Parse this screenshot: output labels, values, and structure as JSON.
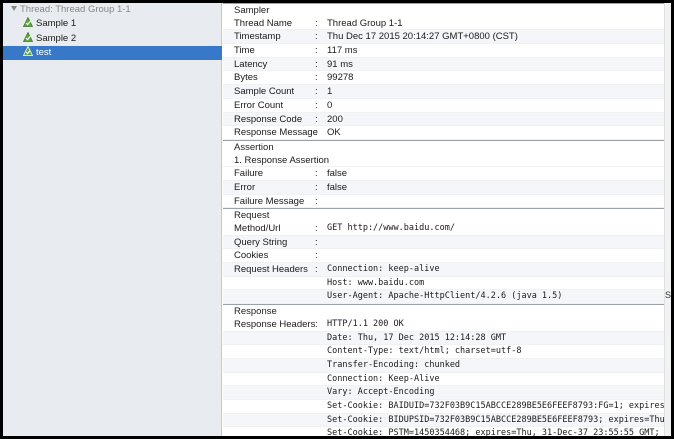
{
  "tree": {
    "root": "Thread: Thread Group 1-1",
    "items": [
      "Sample 1",
      "Sample 2",
      "test"
    ]
  },
  "sampler": {
    "title": "Sampler",
    "rows": [
      {
        "key": "Thread Name",
        "value": "Thread Group 1-1"
      },
      {
        "key": "Timestamp",
        "value": "Thu Dec 17 2015 20:14:27 GMT+0800 (CST)"
      },
      {
        "key": "Time",
        "value": "117 ms"
      },
      {
        "key": "Latency",
        "value": "91 ms"
      },
      {
        "key": "Bytes",
        "value": "99278"
      },
      {
        "key": "Sample Count",
        "value": "1"
      },
      {
        "key": "Error Count",
        "value": "0"
      },
      {
        "key": "Response Code",
        "value": "200"
      },
      {
        "key": "Response Message",
        "value": "OK"
      }
    ]
  },
  "assertion": {
    "title": "Assertion",
    "name": "1. Response Assertion",
    "rows": [
      {
        "key": "Failure",
        "value": "false"
      },
      {
        "key": "Error",
        "value": "false"
      },
      {
        "key": "Failure Message",
        "value": ""
      }
    ]
  },
  "request": {
    "title": "Request",
    "rows": [
      {
        "key": "Method/Url",
        "value": "GET http://www.baidu.com/"
      },
      {
        "key": "Query String",
        "value": ""
      },
      {
        "key": "Cookies",
        "value": ""
      },
      {
        "key": "Request Headers",
        "value": "Connection: keep-alive"
      },
      {
        "key": "",
        "value": "Host: www.baidu.com"
      },
      {
        "key": "",
        "value": "User-Agent: Apache-HttpClient/4.2.6 (java 1.5)"
      }
    ]
  },
  "response": {
    "title": "Response",
    "rows": [
      {
        "key": "Response Headers",
        "value": "HTTP/1.1 200 OK"
      },
      {
        "key": "",
        "value": "Date: Thu, 17 Dec 2015 12:14:28 GMT"
      },
      {
        "key": "",
        "value": "Content-Type: text/html; charset=utf-8"
      },
      {
        "key": "",
        "value": "Transfer-Encoding: chunked"
      },
      {
        "key": "",
        "value": "Connection: Keep-Alive"
      },
      {
        "key": "",
        "value": "Vary: Accept-Encoding"
      },
      {
        "key": "",
        "value": "Set-Cookie: BAIDUID=732F03B9C15ABCCE289BE5E6FEEF8793:FG=1; expires"
      },
      {
        "key": "",
        "value": "Set-Cookie: BIDUPSID=732F03B9C15ABCCE289BE5E6FEEF8793; expires=Thu"
      },
      {
        "key": "",
        "value": "Set-Cookie: PSTM=1450354468; expires=Thu, 31-Dec-37 23:55:55 GMT;"
      }
    ]
  },
  "stray_char": "S",
  "colors": {
    "selection": "#3779c8",
    "tree_bg": "#e8ebef",
    "ok_green": "#5aa83a"
  }
}
